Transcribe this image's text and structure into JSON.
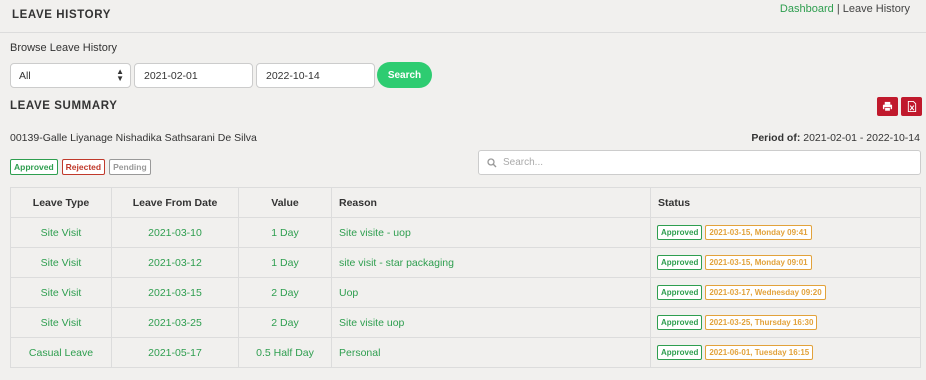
{
  "header": {
    "title": "LEAVE HISTORY",
    "breadcrumb_link": "Dashboard",
    "breadcrumb_sep": "|",
    "breadcrumb_current": "Leave History"
  },
  "filters": {
    "label": "Browse Leave History",
    "type_value": "All",
    "from_date": "2021-02-01",
    "to_date": "2022-10-14",
    "search_label": "Search"
  },
  "summary": {
    "title": "LEAVE SUMMARY",
    "employee": "00139-Galle Liyanage Nishadika Sathsarani De Silva",
    "period_label": "Period of:",
    "period_value": "2021-02-01 - 2022-10-14",
    "legend": {
      "approved": "Approved",
      "rejected": "Rejected",
      "pending": "Pending"
    },
    "search_placeholder": "Search...",
    "print_icon": "print-icon",
    "excel_icon": "excel-icon"
  },
  "colors": {
    "accent_green": "#2ecc71",
    "text_green": "#2e9e4f",
    "danger_red": "#c0192c",
    "pending_orange": "#e2a23b"
  },
  "table": {
    "headers": [
      "Leave Type",
      "Leave From Date",
      "Value",
      "Reason",
      "Status"
    ],
    "rows": [
      {
        "type": "Site Visit",
        "from": "2021-03-10",
        "value": "1 Day",
        "reason": "Site visite - uop",
        "status": "Approved",
        "approved_on": "2021-03-15, Monday 09:41"
      },
      {
        "type": "Site Visit",
        "from": "2021-03-12",
        "value": "1 Day",
        "reason": "site visit - star packaging",
        "status": "Approved",
        "approved_on": "2021-03-15, Monday 09:01"
      },
      {
        "type": "Site Visit",
        "from": "2021-03-15",
        "value": "2 Day",
        "reason": "Uop",
        "status": "Approved",
        "approved_on": "2021-03-17, Wednesday 09:20"
      },
      {
        "type": "Site Visit",
        "from": "2021-03-25",
        "value": "2 Day",
        "reason": "Site visite uop",
        "status": "Approved",
        "approved_on": "2021-03-25, Thursday 16:30"
      },
      {
        "type": "Casual Leave",
        "from": "2021-05-17",
        "value": "0.5 Half Day",
        "reason": "Personal",
        "status": "Approved",
        "approved_on": "2021-06-01, Tuesday 16:15"
      }
    ]
  }
}
